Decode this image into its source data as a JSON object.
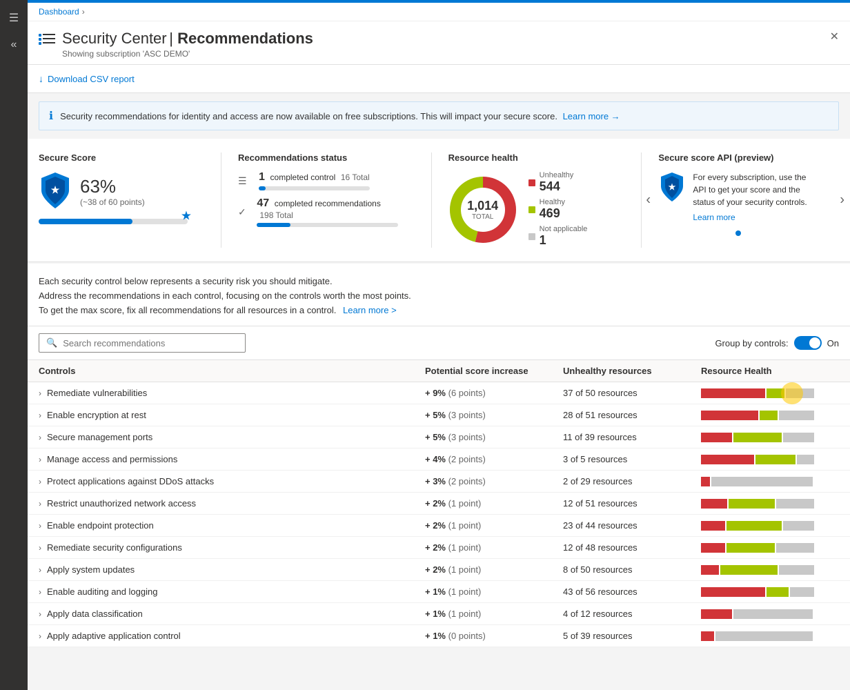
{
  "topbar": {
    "color": "#0078d4"
  },
  "breadcrumb": {
    "label": "Dashboard",
    "separator": "›"
  },
  "header": {
    "icon": "☰",
    "title_prefix": "Security Center",
    "title_separator": " | ",
    "title_main": "Recommendations",
    "subtitle": "Showing subscription 'ASC DEMO'",
    "close_label": "✕"
  },
  "toolbar": {
    "download_label": "Download CSV report",
    "download_icon": "↓"
  },
  "banner": {
    "icon": "ℹ",
    "text": "Security recommendations for identity and access are now available on free subscriptions. This will impact your secure score.",
    "link_text": "Learn more →"
  },
  "metrics": {
    "secure_score": {
      "title": "Secure Score",
      "percent": "63%",
      "detail": "(~38 of 60 points)",
      "bar_pct": 63
    },
    "recommendations_status": {
      "title": "Recommendations status",
      "completed_controls": 1,
      "completed_controls_label": "completed control",
      "total_controls": "16 Total",
      "controls_bar_pct": 6,
      "completed_recs": 47,
      "completed_recs_label": "completed recommendations",
      "total_recs": "198 Total",
      "recs_bar_pct": 24
    },
    "resource_health": {
      "title": "Resource health",
      "total": "1,014",
      "total_label": "TOTAL",
      "unhealthy_label": "Unhealthy",
      "unhealthy_value": "544",
      "healthy_label": "Healthy",
      "healthy_value": "469",
      "na_label": "Not applicable",
      "na_value": "1",
      "donut_unhealthy_pct": 54,
      "donut_healthy_pct": 46
    },
    "secure_score_api": {
      "title": "Secure score API (preview)",
      "description": "For every subscription, use the API to get your score and the status of your security controls.",
      "link_text": "Learn more"
    }
  },
  "intro": {
    "line1": "Each security control below represents a security risk you should mitigate.",
    "line2": "Address the recommendations in each control, focusing on the controls worth the most points.",
    "line3_prefix": "To get the max score, fix all recommendations for all resources in a control.",
    "line3_link": "Learn more >"
  },
  "search": {
    "placeholder": "Search recommendations"
  },
  "group_by": {
    "label": "Group by controls:",
    "state": "On"
  },
  "table": {
    "columns": [
      "Controls",
      "Potential score increase",
      "Unhealthy resources",
      "Resource Health"
    ],
    "rows": [
      {
        "name": "Remediate vulnerabilities",
        "score_increase": "+ 9%",
        "score_points": "(6 points)",
        "unhealthy": "37 of 50 resources",
        "red_pct": 58,
        "green_pct": 16,
        "gray_pct": 26
      },
      {
        "name": "Enable encryption at rest",
        "score_increase": "+ 5%",
        "score_points": "(3 points)",
        "unhealthy": "28 of 51 resources",
        "red_pct": 52,
        "green_pct": 16,
        "gray_pct": 32
      },
      {
        "name": "Secure management ports",
        "score_increase": "+ 5%",
        "score_points": "(3 points)",
        "unhealthy": "11 of 39 resources",
        "red_pct": 28,
        "green_pct": 44,
        "gray_pct": 28
      },
      {
        "name": "Manage access and permissions",
        "score_increase": "+ 4%",
        "score_points": "(2 points)",
        "unhealthy": "3 of 5 resources",
        "red_pct": 48,
        "green_pct": 36,
        "gray_pct": 16
      },
      {
        "name": "Protect applications against DDoS attacks",
        "score_increase": "+ 3%",
        "score_points": "(2 points)",
        "unhealthy": "2 of 29 resources",
        "red_pct": 8,
        "green_pct": 0,
        "gray_pct": 92
      },
      {
        "name": "Restrict unauthorized network access",
        "score_increase": "+ 2%",
        "score_points": "(1 point)",
        "unhealthy": "12 of 51 resources",
        "red_pct": 24,
        "green_pct": 42,
        "gray_pct": 34
      },
      {
        "name": "Enable endpoint protection",
        "score_increase": "+ 2%",
        "score_points": "(1 point)",
        "unhealthy": "23 of 44 resources",
        "red_pct": 22,
        "green_pct": 50,
        "gray_pct": 28
      },
      {
        "name": "Remediate security configurations",
        "score_increase": "+ 2%",
        "score_points": "(1 point)",
        "unhealthy": "12 of 48 resources",
        "red_pct": 22,
        "green_pct": 44,
        "gray_pct": 34
      },
      {
        "name": "Apply system updates",
        "score_increase": "+ 2%",
        "score_points": "(1 point)",
        "unhealthy": "8 of 50 resources",
        "red_pct": 16,
        "green_pct": 52,
        "gray_pct": 32
      },
      {
        "name": "Enable auditing and logging",
        "score_increase": "+ 1%",
        "score_points": "(1 point)",
        "unhealthy": "43 of 56 resources",
        "red_pct": 58,
        "green_pct": 20,
        "gray_pct": 22
      },
      {
        "name": "Apply data classification",
        "score_increase": "+ 1%",
        "score_points": "(1 point)",
        "unhealthy": "4 of 12 resources",
        "red_pct": 28,
        "green_pct": 0,
        "gray_pct": 72
      },
      {
        "name": "Apply adaptive application control",
        "score_increase": "+ 1%",
        "score_points": "(0 points)",
        "unhealthy": "5 of 39 resources",
        "red_pct": 12,
        "green_pct": 0,
        "gray_pct": 88
      }
    ]
  }
}
